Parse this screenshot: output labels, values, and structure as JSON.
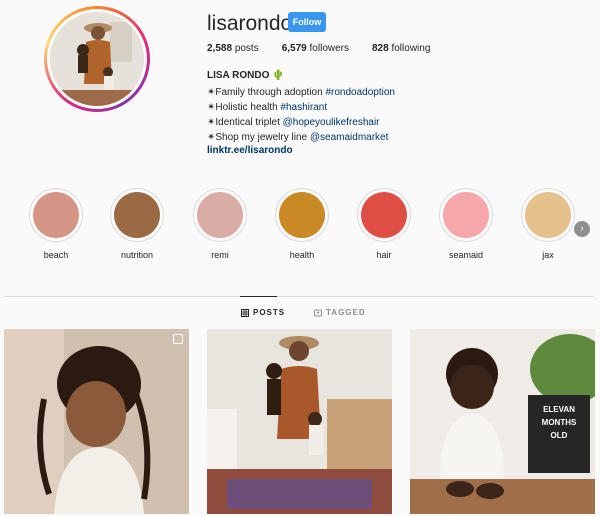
{
  "profile": {
    "username": "lisarondo",
    "follow_label": "Follow",
    "stats": {
      "posts_count": "2,588",
      "posts_label": "posts",
      "followers_count": "6,579",
      "followers_label": "followers",
      "following_count": "828",
      "following_label": "following"
    },
    "full_name": "LISA RONDO 🌵",
    "bio": [
      {
        "text": "✴Family through adoption ",
        "link": "#rondoadoption"
      },
      {
        "text": "✴Holistic health ",
        "link": "#hashirant"
      },
      {
        "text": "✴Identical triplet ",
        "link": "@hopeyoulikefreshair"
      },
      {
        "text": "✴Shop my jewelry line ",
        "link": "@seamaidmarket"
      }
    ],
    "url": "linktr.ee/lisarondo"
  },
  "highlights": [
    {
      "label": "beach",
      "color": "#d39585"
    },
    {
      "label": "nutrition",
      "color": "#9a6a45"
    },
    {
      "label": "remi",
      "color": "#d9ada6"
    },
    {
      "label": "health",
      "color": "#c98a25"
    },
    {
      "label": "hair",
      "color": "#de4e45"
    },
    {
      "label": "seamaid",
      "color": "#f5a7a9"
    },
    {
      "label": "jax",
      "color": "#e4c08a"
    }
  ],
  "tabs": {
    "posts": "POSTS",
    "tagged": "TAGGED"
  },
  "posts": [
    {
      "letterboard": []
    },
    {
      "letterboard": []
    },
    {
      "letterboard": [
        "ELEVAN",
        "MONTHS",
        "OLD"
      ]
    }
  ],
  "icons": {
    "highlight_next": "chevron-right-icon",
    "posts_tab": "grid-icon",
    "tagged_tab": "tag-icon",
    "multi_post": "carousel-icon"
  }
}
